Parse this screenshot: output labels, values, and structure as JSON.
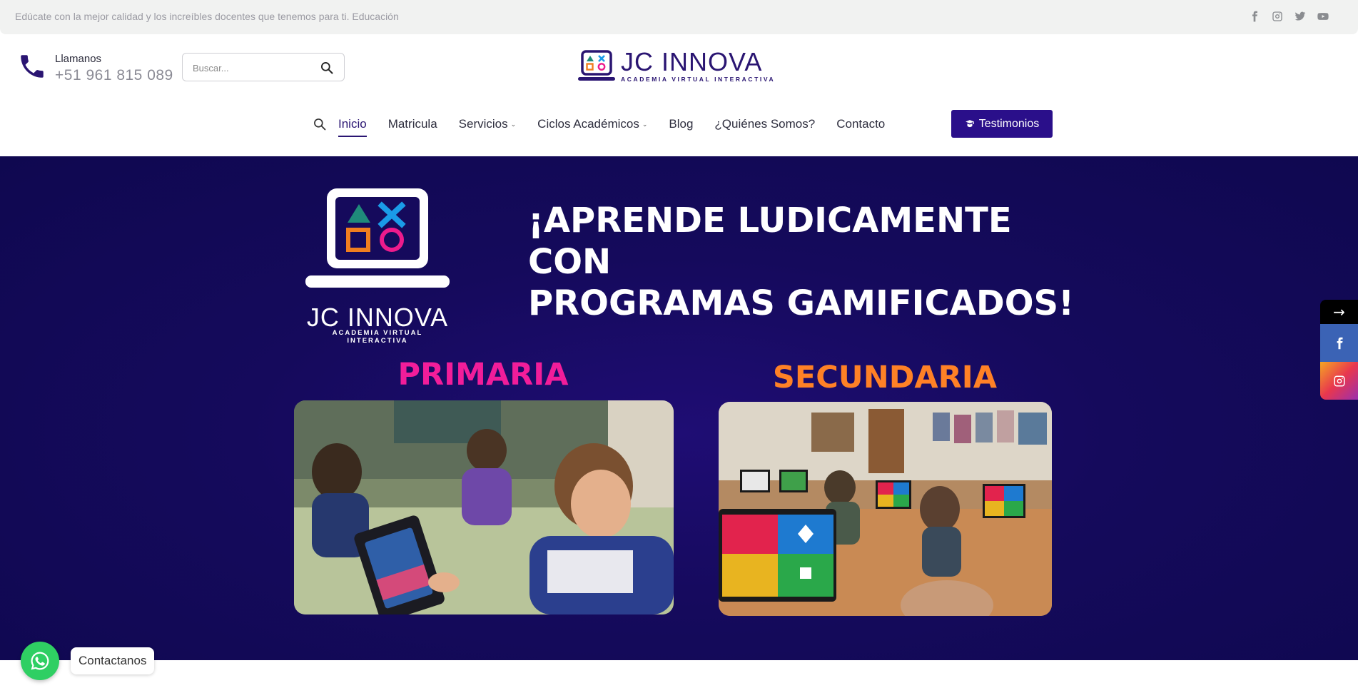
{
  "topbar": {
    "text": "Edúcate con la mejor calidad y los increíbles docentes que tenemos para ti. Educación",
    "socials": [
      "facebook-icon",
      "instagram-icon",
      "twitter-icon",
      "youtube-icon"
    ]
  },
  "header": {
    "phone_label": "Llamanos",
    "phone_number": "+51 961 815 089",
    "search_placeholder": "Buscar...",
    "logo_title": "JC INNOVA",
    "logo_subtitle": "ACADEMIA VIRTUAL INTERACTIVA"
  },
  "nav": {
    "items": [
      {
        "label": "Inicio",
        "active": true
      },
      {
        "label": "Matricula"
      },
      {
        "label": "Servicios",
        "dropdown": true
      },
      {
        "label": "Ciclos Académicos",
        "dropdown": true
      },
      {
        "label": "Blog"
      },
      {
        "label": "¿Quiénes Somos?"
      },
      {
        "label": "Contacto"
      }
    ],
    "cta_label": "Testimonios"
  },
  "hero": {
    "logo_title": "JC INNOVA",
    "logo_subtitle": "ACADEMIA VIRTUAL INTERACTIVA",
    "headline_line1": "¡APRENDE LUDICAMENTE CON",
    "headline_line2": "PROGRAMAS GAMIFICADOS!",
    "primaria_label": "PRIMARIA",
    "secundaria_label": "SECUNDARIA"
  },
  "side_socials": {
    "arrow": "→",
    "items": [
      "facebook-icon",
      "instagram-icon"
    ]
  },
  "whatsapp": {
    "label": "Contactanos"
  },
  "colors": {
    "brand": "#2a1572",
    "hero_bg": "#150a5c",
    "primaria": "#f21d9a",
    "secundaria": "#ff8126",
    "cta": "#2a0f8a",
    "whatsapp": "#2fcf63"
  }
}
